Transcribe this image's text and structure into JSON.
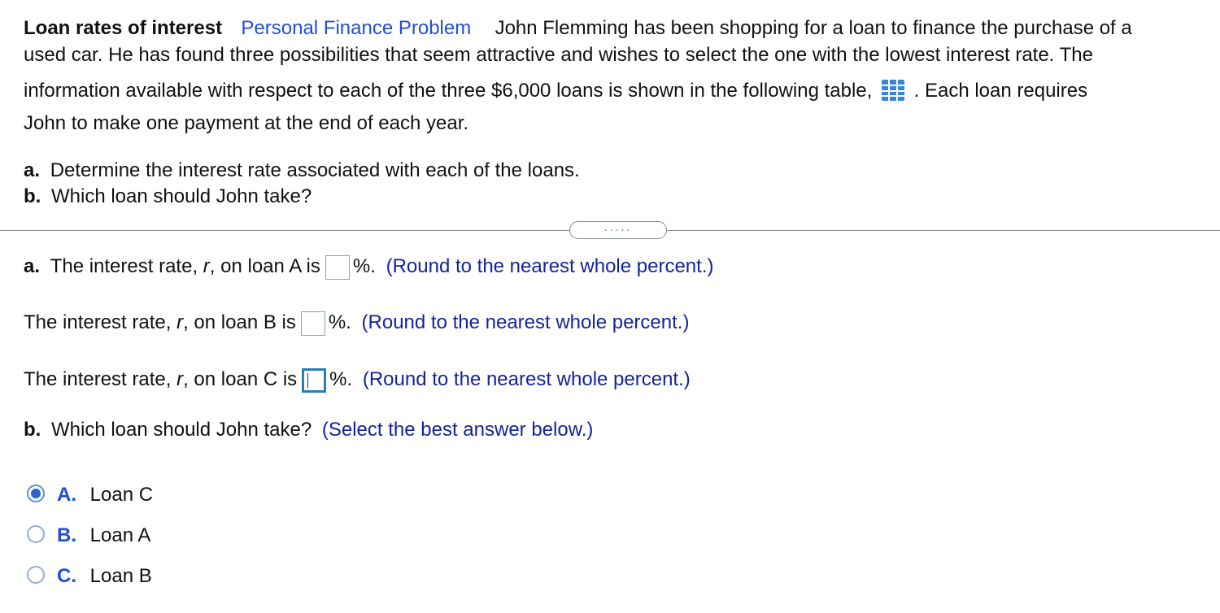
{
  "problem": {
    "title": "Loan rates of interest",
    "category": "Personal Finance Problem",
    "line1_text": "John Flemming has been shopping for a loan to finance the purchase of a",
    "line2_text": "used car.  He has found three possibilities that seem attractive and wishes to select the one with the lowest interest rate.  The",
    "line3_text_before": "information available with respect to each of the three $6,000 loans is shown in the following table,",
    "line3_text_after": ". Each loan requires",
    "line4_text": "John to make one payment at the end of each year.",
    "table_icon": "table-grid-icon"
  },
  "questions": {
    "a_letter": "a.",
    "a_text": "Determine the interest rate associated with each of the loans.",
    "b_letter": "b.",
    "b_text": "Which loan should John take?"
  },
  "expand_dots": ".....",
  "answers": {
    "a_letter": "a.",
    "loan_a_prefix": "The interest rate, ",
    "r_symbol": "r",
    "loan_a_suffix": ", on loan A is",
    "loan_b_suffix": ", on loan B is",
    "loan_c_suffix": ", on loan C is",
    "percent_suffix": "%.",
    "round_hint": "(Round to the nearest whole percent.)",
    "loan_a_value": "",
    "loan_b_value": "",
    "loan_c_value": ""
  },
  "part_b": {
    "letter": "b.",
    "question": "Which loan should John take?",
    "hint": "(Select the best answer below.)",
    "options": [
      {
        "letter": "A.",
        "label": "Loan C",
        "selected": true
      },
      {
        "letter": "B.",
        "label": "Loan A",
        "selected": false
      },
      {
        "letter": "C.",
        "label": "Loan B",
        "selected": false
      }
    ]
  }
}
